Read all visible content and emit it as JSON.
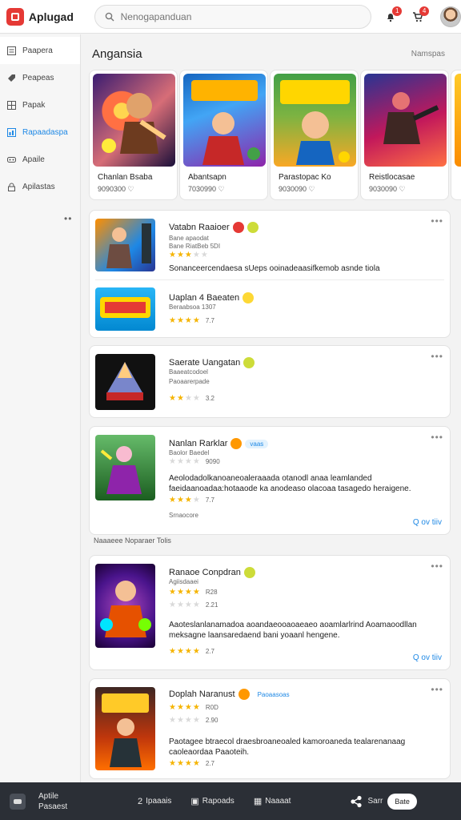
{
  "header": {
    "brand": "Aplugad",
    "search_placeholder": "Nenogapanduan",
    "notif_badge": "1",
    "cart_badge": "4"
  },
  "sidebar": {
    "items": [
      {
        "label": "Paapera",
        "icon": "list-icon"
      },
      {
        "label": "Peapeas",
        "icon": "tag-icon"
      },
      {
        "label": "Papak",
        "icon": "grid-icon"
      },
      {
        "label": "Rapaadaspa",
        "icon": "chart-icon"
      },
      {
        "label": "Apaile",
        "icon": "gamepad-icon"
      },
      {
        "label": "Apilastas",
        "icon": "lock-icon"
      }
    ],
    "more": "••"
  },
  "section": {
    "title": "Angansia",
    "more": "Namspas"
  },
  "games": [
    {
      "name": "Chanlan Bsaba",
      "meta": "9090300 ♡"
    },
    {
      "name": "Abantsapn",
      "meta": "7030990 ♡"
    },
    {
      "name": "Parastopac Ko",
      "meta": "9030090 ♡"
    },
    {
      "name": "Reistlocasae",
      "meta": "9030090 ♡"
    }
  ],
  "list": [
    {
      "title": "Vatabn Raaioer",
      "sub": "Bane apaodat",
      "sub2": "Bane RiatBeb 5DI",
      "rating": "",
      "desc": "Sonanceercendaesa sUeps ooinadeaasifkemob asnde tiola"
    },
    {
      "title": "Uaplan 4 Baeaten",
      "sub": "Beraabsoa 1307",
      "rating": "7.7",
      "desc": ""
    },
    {
      "title": "Saerate Uangatan",
      "sub": "Baaeatcodoel",
      "sub2": "Paoaarerpade",
      "rating": "3.2",
      "desc": ""
    },
    {
      "title": "Nanlan Rarklar",
      "sub": "Baolor Baedel",
      "sub2": "9090",
      "rating": "7.7",
      "desc": "Aeolodadolkanoaneoaleraaada otanodl anaa leamlanded faeidaanoadaa:hotaaode ka anodeaso olacoaa tasagedo heraigene.",
      "tag": "vaas",
      "label": "Srnaocore",
      "link": "Q ov tiiv"
    },
    {
      "title": "Ranaoe Conpdran",
      "sub": "Agiisdaaei",
      "sub2": "R28",
      "rating": "2.21",
      "desc": "Aaoteslanlanamadoa aoandaeooaoaeaeo aoamlarlrind Aoamaoodllan meksagne laansaredaend bani yoaanl hengene.",
      "rating2": "2.7",
      "link": "Q ov tiiv"
    },
    {
      "title": "Doplah Naranust",
      "sub": "R0D",
      "sub2": "2.90",
      "rating": "2.7",
      "desc": "Paotagee btraecol draesbroaneoaled kamoroaneda tealarenanaag caoleaordaa Paaoteih.",
      "tag": "Paoaasoas"
    }
  ],
  "section2_label": "Naaaeee Noparaer Tolis",
  "bottom": {
    "brand_line1": "Aptile",
    "brand_line2": "Pasaest",
    "items": [
      {
        "glyph": "2",
        "label": "Ipaaais"
      },
      {
        "glyph": "▣",
        "label": "Rapoads"
      },
      {
        "glyph": "▦",
        "label": "Naaaat"
      }
    ],
    "share_label": "Sarr",
    "button": "Bate"
  }
}
